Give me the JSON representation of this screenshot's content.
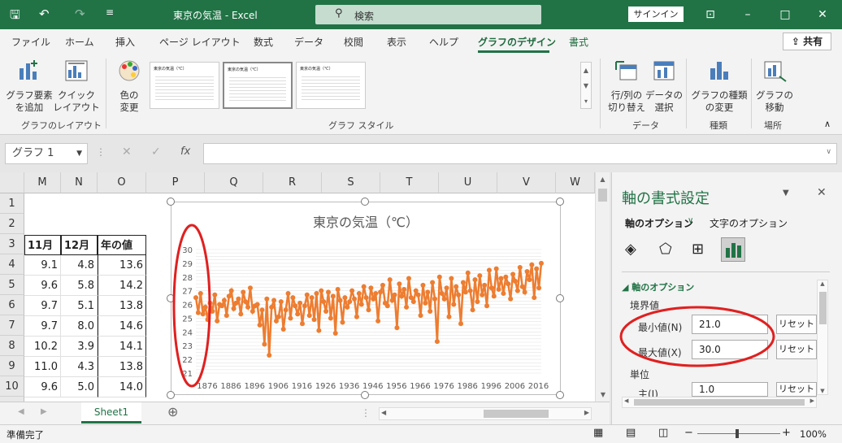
{
  "window": {
    "title": "東京の気温  -  Excel",
    "search_placeholder": "検索",
    "signin": "サインイン"
  },
  "tabs": [
    {
      "label": "ファイル"
    },
    {
      "label": "ホーム"
    },
    {
      "label": "挿入"
    },
    {
      "label": "ページ レイアウト"
    },
    {
      "label": "数式"
    },
    {
      "label": "データ"
    },
    {
      "label": "校閲"
    },
    {
      "label": "表示"
    },
    {
      "label": "ヘルプ"
    },
    {
      "label": "グラフのデザイン"
    },
    {
      "label": "書式"
    }
  ],
  "share": "共有",
  "ribbon": {
    "add_element": [
      "グラフ要素",
      "を追加"
    ],
    "quick_layout": [
      "クイック",
      "レイアウト"
    ],
    "color_change": [
      "色の",
      "変更"
    ],
    "group_layout": "グラフのレイアウト",
    "group_style": "グラフ スタイル",
    "thumb_title": "東京の気温（℃）",
    "switch_row_col": [
      "行/列の",
      "切り替え"
    ],
    "select_data": [
      "データの",
      "選択"
    ],
    "group_data": "データ",
    "change_type": [
      "グラフの種類",
      "の変更"
    ],
    "group_type": "種類",
    "move_chart": [
      "グラフの",
      "移動"
    ],
    "group_location": "場所"
  },
  "namebox": "グラフ 1",
  "columns": [
    "M",
    "N",
    "O",
    "P",
    "Q",
    "R",
    "S",
    "T",
    "U",
    "V",
    "W"
  ],
  "rows": [
    "1",
    "2",
    "3",
    "4",
    "5",
    "6",
    "7",
    "8",
    "9",
    "10"
  ],
  "table": {
    "headers": [
      "11月",
      "12月",
      "年の値"
    ],
    "data": [
      [
        "9.1",
        "4.8",
        "13.6"
      ],
      [
        "9.6",
        "5.8",
        "14.2"
      ],
      [
        "9.7",
        "5.1",
        "13.8"
      ],
      [
        "9.7",
        "8.0",
        "14.6"
      ],
      [
        "10.2",
        "3.9",
        "14.1"
      ],
      [
        "11.0",
        "4.3",
        "13.8"
      ],
      [
        "9.6",
        "5.0",
        "14.0"
      ]
    ]
  },
  "chart_data": {
    "type": "line",
    "title": "東京の気温（℃）",
    "ylim": [
      21,
      30
    ],
    "yticks": [
      "30",
      "29",
      "28",
      "27",
      "26",
      "25",
      "24",
      "23",
      "22",
      "21"
    ],
    "xticks": [
      "1876",
      "1886",
      "1896",
      "1906",
      "1916",
      "1926",
      "1936",
      "1946",
      "1956",
      "1966",
      "1976",
      "1986",
      "1996",
      "2006",
      "2016"
    ],
    "series_color": "#ED7D31",
    "x_start": 1876,
    "values": [
      26.5,
      25.4,
      26.8,
      25.3,
      25.8,
      24.9,
      26.1,
      25.5,
      26.7,
      24.8,
      26.0,
      25.9,
      26.3,
      25.2,
      26.6,
      27.0,
      25.7,
      26.1,
      26.4,
      25.3,
      26.9,
      26.2,
      25.8,
      27.2,
      25.5,
      25.9,
      26.0,
      24.5,
      25.6,
      23.1,
      26.4,
      22.3,
      25.8,
      26.3,
      24.8,
      25.1,
      26.2,
      24.2,
      25.6,
      26.8,
      25.0,
      26.5,
      25.9,
      25.3,
      26.1,
      24.6,
      25.9,
      26.7,
      25.2,
      26.5,
      24.9,
      26.8,
      24.1,
      27.0,
      26.2,
      25.5,
      26.9,
      25.0,
      26.6,
      23.9,
      27.1,
      26.3,
      24.7,
      26.5,
      25.8,
      26.2,
      27.0,
      26.4,
      25.1,
      26.8,
      26.0,
      27.3,
      26.5,
      25.6,
      27.2,
      26.4,
      26.8,
      24.8,
      26.9,
      27.4,
      26.1,
      25.9,
      27.8,
      26.3,
      26.7,
      24.3,
      27.5,
      26.6,
      27.1,
      25.8,
      27.9,
      26.5,
      26.2,
      27.0,
      26.7,
      25.2,
      27.4,
      26.1,
      26.9,
      25.5,
      27.6,
      26.4,
      23.3,
      28.0,
      26.8,
      26.4,
      27.2,
      25.1,
      27.9,
      26.0,
      27.3,
      26.7,
      24.6,
      27.6,
      26.9,
      28.3,
      27.0,
      25.6,
      27.8,
      26.2,
      28.1,
      26.7,
      27.4,
      25.9,
      28.5,
      27.2,
      26.6,
      28.6,
      27.1,
      27.9,
      26.8,
      28.0,
      27.5,
      26.4,
      28.2,
      27.7,
      27.0,
      28.7,
      27.3,
      26.9,
      28.4,
      27.8,
      28.9,
      26.5,
      28.6,
      27.2,
      29.0
    ]
  },
  "pane": {
    "title": "軸の書式設定",
    "tab_axis": "軸のオプション",
    "tab_text": "文字のオプション",
    "section": "軸のオプション",
    "bounds": "境界値",
    "min_label": "最小値(N)",
    "min_value": "21.0",
    "max_label": "最大値(X)",
    "max_value": "30.0",
    "reset": "リセット",
    "units": "単位",
    "major_label": "主(J)",
    "major_value": "1.0"
  },
  "sheet_tab": "Sheet1",
  "status": {
    "ready": "準備完了",
    "zoom": "100%"
  }
}
